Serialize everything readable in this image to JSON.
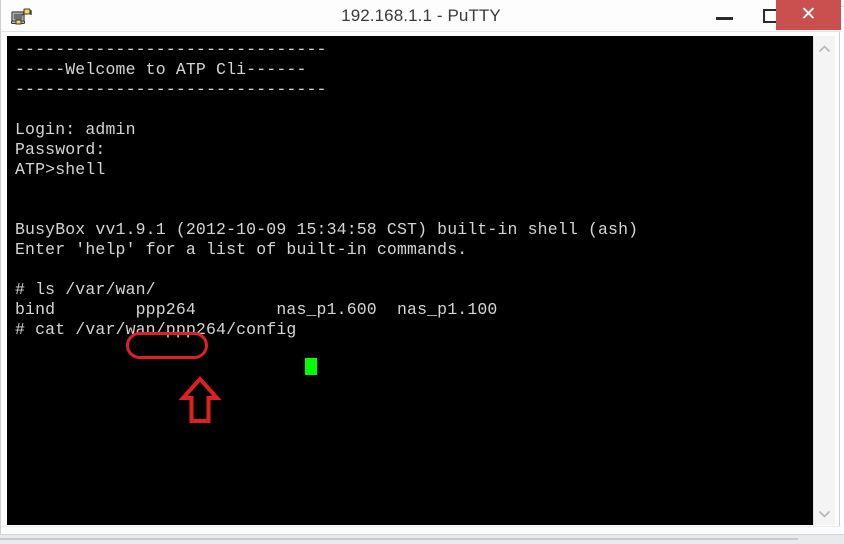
{
  "window": {
    "title": "192.168.1.1 - PuTTY",
    "icon_name": "putty-computer-plug-icon",
    "controls": {
      "minimize_label": "—",
      "maximize_label": "□",
      "close_label": "✕"
    }
  },
  "terminal": {
    "background_color": "#000000",
    "text_color": "#d5d5d5",
    "cursor_color": "#00ff00",
    "lines": [
      "-------------------------------",
      "-----Welcome to ATP Cli------",
      "-------------------------------",
      "",
      "Login: admin",
      "Password:",
      "ATP>shell",
      "",
      "",
      "BusyBox vv1.9.1 (2012-10-09 15:34:58 CST) built-in shell (ash)",
      "Enter 'help' for a list of built-in commands.",
      "",
      "# ls /var/wan/",
      "bind        ppp264        nas_p1.600  nas_p1.100",
      "# cat /var/wan/ppp264/config "
    ],
    "content": "-------------------------------\n-----Welcome to ATP Cli------\n-------------------------------\n\nLogin: admin\nPassword:\nATP>shell\n\n\nBusyBox vv1.9.1 (2012-10-09 15:34:58 CST) built-in shell (ash)\nEnter 'help' for a list of built-in commands.\n\n# ls /var/wan/\nbind        ppp264        nas_p1.600  nas_p1.100\n# cat /var/wan/ppp264/config "
  },
  "annotations": {
    "highlight_color": "#e02020",
    "oval_target": "ppp264",
    "arrow_direction": "up"
  },
  "scrollbar": {
    "up_glyph": "ⱏ",
    "down_glyph": "ⱛ"
  }
}
